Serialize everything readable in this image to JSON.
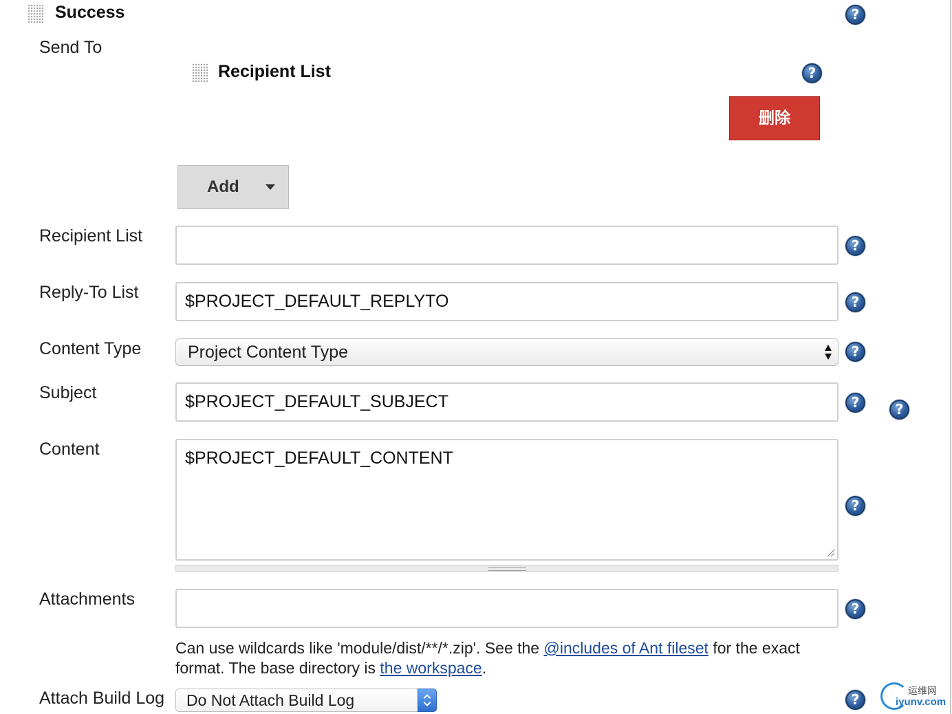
{
  "sections": {
    "success_title": "Success",
    "send_to_label": "Send To",
    "recipient_list_title": "Recipient List",
    "delete_button": "删除",
    "add_button": "Add"
  },
  "fields": {
    "recipient_list": {
      "label": "Recipient List",
      "value": ""
    },
    "reply_to_list": {
      "label": "Reply-To List",
      "value": "$PROJECT_DEFAULT_REPLYTO"
    },
    "content_type": {
      "label": "Content Type",
      "value": "Project Content Type"
    },
    "subject": {
      "label": "Subject",
      "value": "$PROJECT_DEFAULT_SUBJECT"
    },
    "content": {
      "label": "Content",
      "value": "$PROJECT_DEFAULT_CONTENT"
    },
    "attachments": {
      "label": "Attachments",
      "value": ""
    },
    "attach_build_log": {
      "label": "Attach Build Log",
      "value": "Do Not Attach Build Log"
    }
  },
  "attachments_help": {
    "part1": "Can use wildcards like 'module/dist/**/*.zip'. See the ",
    "link1": "@includes of Ant fileset",
    "part2": " for the exact format. The base directory is ",
    "link2": "the workspace",
    "part3": "."
  },
  "help_icon_text": "?",
  "watermark": {
    "top": "运维网",
    "bottom": "iyunv.com"
  },
  "colors": {
    "delete": "#cf3a30",
    "help": "#2d5d9e",
    "link": "#1f4b9c"
  }
}
